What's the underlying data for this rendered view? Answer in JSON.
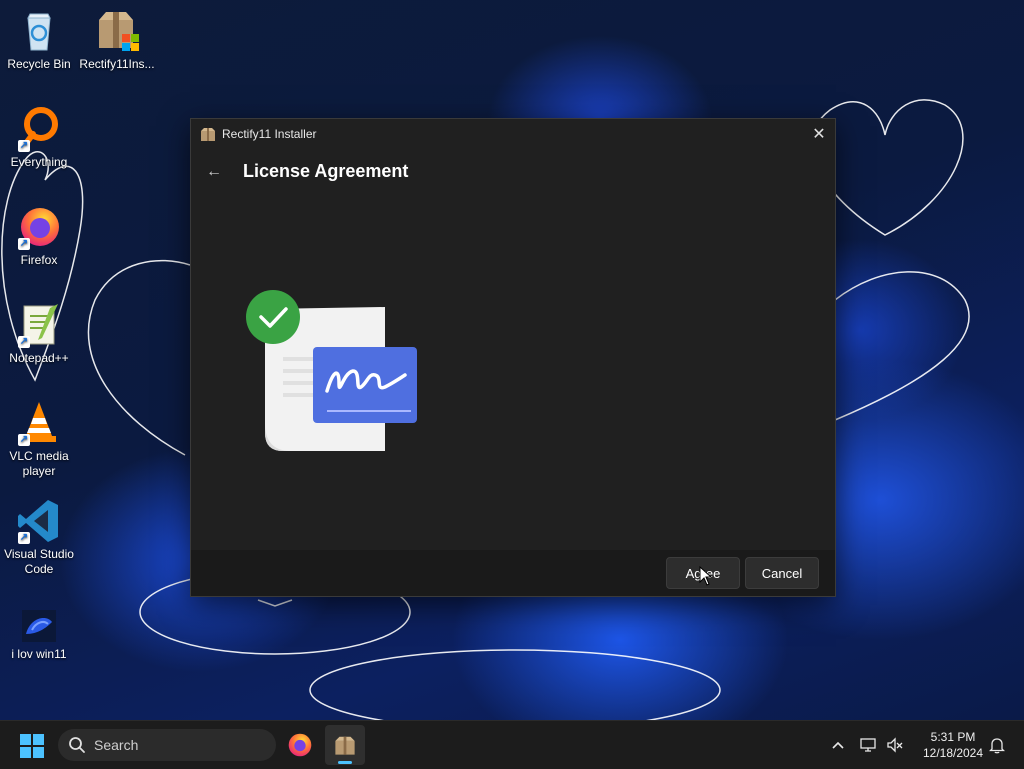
{
  "desktop": {
    "icons": [
      {
        "label": "Recycle Bin",
        "icon": "recycle-bin-icon"
      },
      {
        "label": "Rectify11Ins...",
        "icon": "installer-package-icon"
      },
      {
        "label": "Everything",
        "icon": "everything-search-icon"
      },
      {
        "label": "Firefox",
        "icon": "firefox-icon"
      },
      {
        "label": "Notepad++",
        "icon": "notepad-plus-plus-icon"
      },
      {
        "label": "VLC media player",
        "icon": "vlc-icon"
      },
      {
        "label": "Visual Studio Code",
        "icon": "vscode-icon"
      },
      {
        "label": "i lov win11",
        "icon": "image-file-icon"
      }
    ]
  },
  "installer": {
    "window_title": "Rectify11 Installer",
    "close_glyph": "✕",
    "back_glyph": "←",
    "heading": "License Agreement",
    "illustration": "license-document-signature-icon",
    "buttons": {
      "agree": "Agree",
      "cancel": "Cancel"
    }
  },
  "taskbar": {
    "search_placeholder": "Search",
    "clock": {
      "time": "5:31 PM",
      "date": "12/18/2024"
    },
    "tray_chevron": "^"
  },
  "colors": {
    "window_bg": "#202020",
    "footer_bg": "#1a1a1a",
    "taskbar_bg": "#1c1c1c",
    "accent": "#4cc2ff",
    "check_green": "#3aa344",
    "signature_blue": "#4f6fe0"
  }
}
